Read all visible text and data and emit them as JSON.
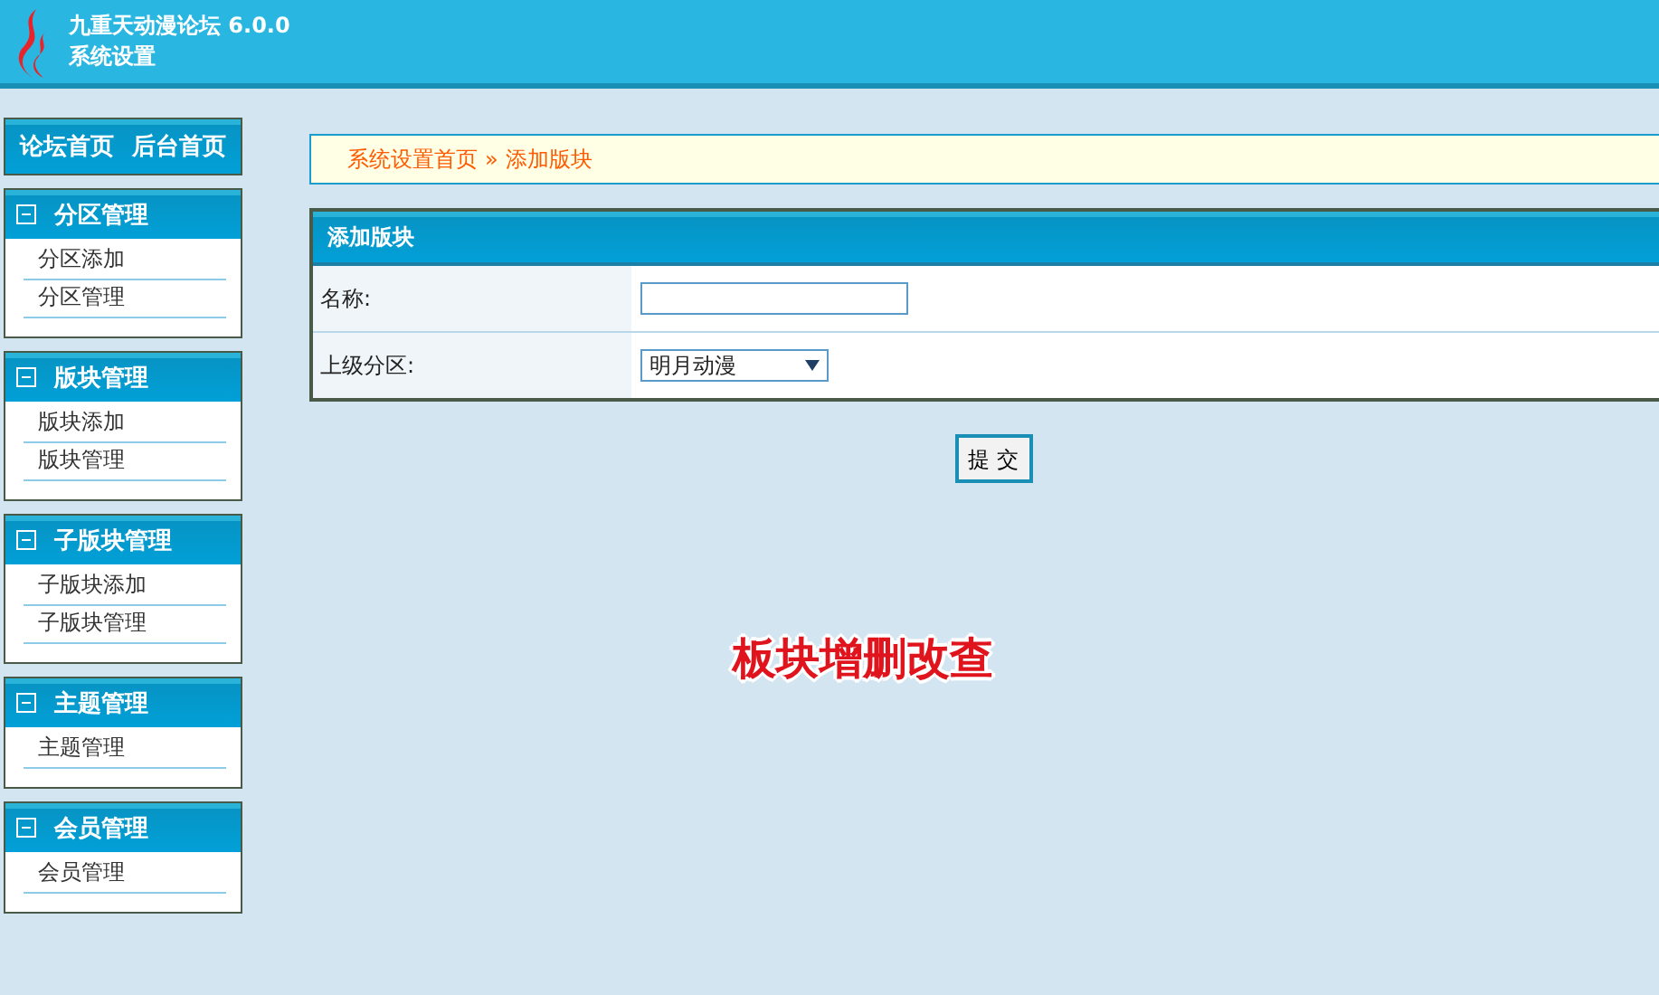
{
  "header": {
    "title": "九重天动漫论坛 6.0.0",
    "subtitle": "系统设置"
  },
  "top_links": [
    {
      "label": "论坛首页"
    },
    {
      "label": "后台首页"
    }
  ],
  "sidebar": [
    {
      "title": "分区管理",
      "expanded": true,
      "items": [
        "分区添加",
        "分区管理"
      ]
    },
    {
      "title": "版块管理",
      "expanded": true,
      "items": [
        "版块添加",
        "版块管理"
      ]
    },
    {
      "title": "子版块管理",
      "expanded": true,
      "items": [
        "子版块添加",
        "子版块管理"
      ]
    },
    {
      "title": "主题管理",
      "expanded": true,
      "items": [
        "主题管理"
      ]
    },
    {
      "title": "会员管理",
      "expanded": true,
      "items": [
        "会员管理"
      ]
    }
  ],
  "breadcrumb": {
    "items": [
      "系统设置首页",
      "添加版块"
    ],
    "separator": "»"
  },
  "form": {
    "title": "添加版块",
    "fields": [
      {
        "kind": "text",
        "label": "名称:"
      },
      {
        "kind": "select",
        "label": "上级分区:",
        "value": "明月动漫"
      }
    ],
    "submit": "提 交"
  },
  "caption": "板块增删改查"
}
